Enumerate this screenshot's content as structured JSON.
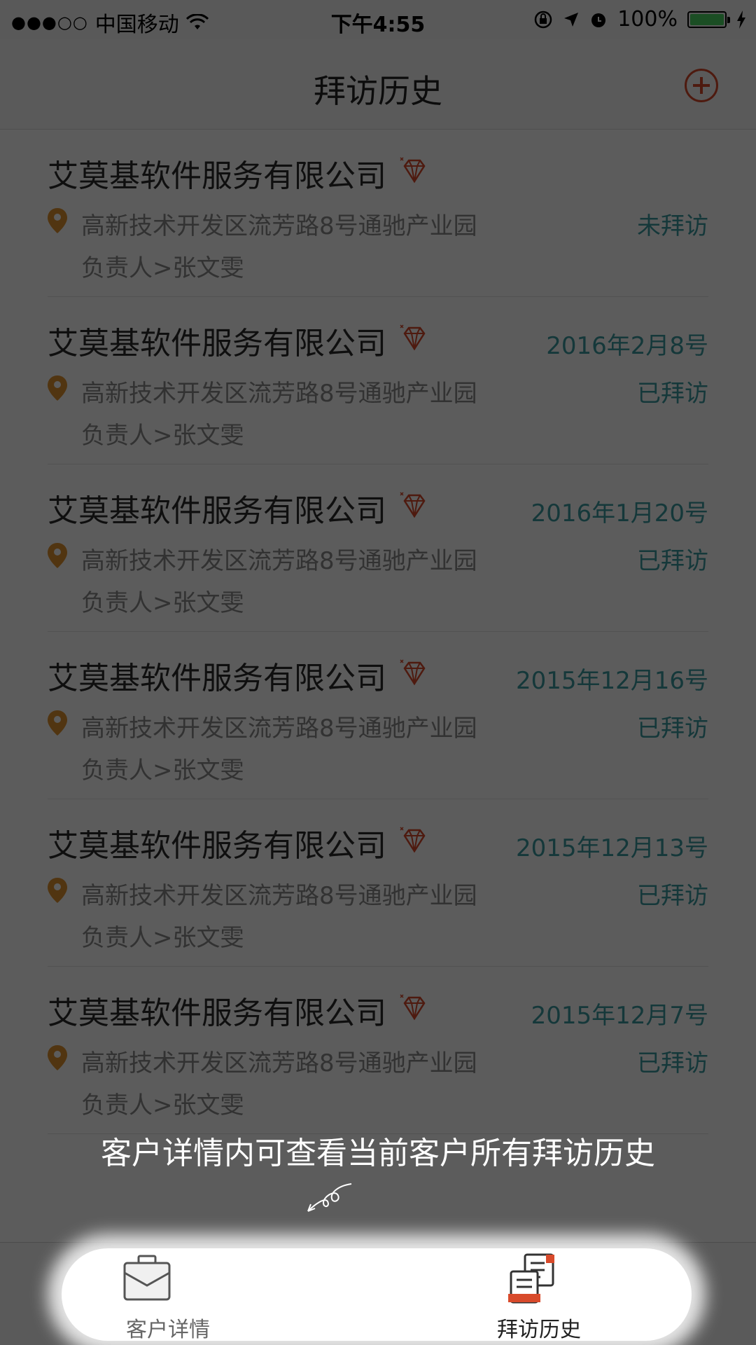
{
  "status_bar": {
    "signal": "●●●○○",
    "carrier": "中国移动",
    "time": "下午4:55",
    "battery": "100%"
  },
  "nav": {
    "title": "拜访历史"
  },
  "visits": [
    {
      "company": "艾莫基软件服务有限公司",
      "date": "",
      "address": "高新技术开发区流芳路8号通驰产业园",
      "status": "未拜访",
      "manager": "负责人>张文雯"
    },
    {
      "company": "艾莫基软件服务有限公司",
      "date": "2016年2月8号",
      "address": "高新技术开发区流芳路8号通驰产业园",
      "status": "已拜访",
      "manager": "负责人>张文雯"
    },
    {
      "company": "艾莫基软件服务有限公司",
      "date": "2016年1月20号",
      "address": "高新技术开发区流芳路8号通驰产业园",
      "status": "已拜访",
      "manager": "负责人>张文雯"
    },
    {
      "company": "艾莫基软件服务有限公司",
      "date": "2015年12月16号",
      "address": "高新技术开发区流芳路8号通驰产业园",
      "status": "已拜访",
      "manager": "负责人>张文雯"
    },
    {
      "company": "艾莫基软件服务有限公司",
      "date": "2015年12月13号",
      "address": "高新技术开发区流芳路8号通驰产业园",
      "status": "已拜访",
      "manager": "负责人>张文雯"
    },
    {
      "company": "艾莫基软件服务有限公司",
      "date": "2015年12月7号",
      "address": "高新技术开发区流芳路8号通驰产业园",
      "status": "已拜访",
      "manager": "负责人>张文雯"
    }
  ],
  "tabs": {
    "customer_detail": "客户详情",
    "visit_history": "拜访历史"
  },
  "guide": {
    "text": "客户详情内可查看当前客户所有拜访历史"
  },
  "colors": {
    "accent_red": "#d84a2b",
    "teal": "#3a9ba0",
    "pin_orange": "#e0922f"
  }
}
